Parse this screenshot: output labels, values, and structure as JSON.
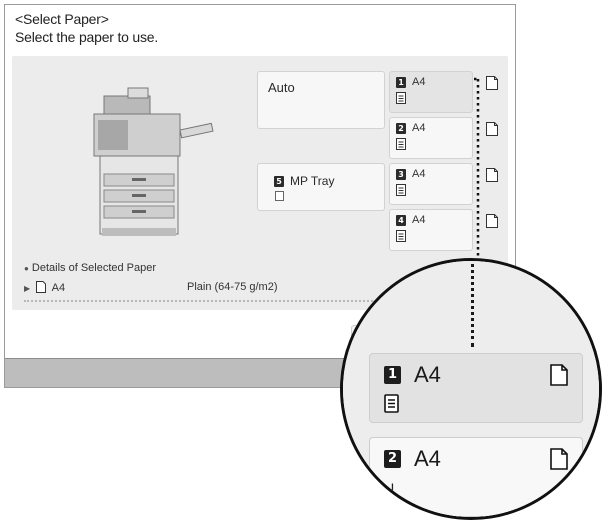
{
  "header": {
    "title": "<Select Paper>",
    "instruction": "Select the paper to use."
  },
  "sources": {
    "auto": {
      "label": "Auto"
    },
    "mp_tray": {
      "badge": "5",
      "label": "MP Tray"
    }
  },
  "drawers": [
    {
      "badge": "1",
      "size": "A4",
      "selected": true
    },
    {
      "badge": "2",
      "size": "A4",
      "selected": false
    },
    {
      "badge": "3",
      "size": "A4",
      "selected": false
    },
    {
      "badge": "4",
      "size": "A4",
      "selected": false
    }
  ],
  "details": {
    "title": "Details of Selected Paper",
    "size": "A4",
    "type": "Plain (64-75 g/m2)"
  },
  "magnifier": {
    "drawer1": {
      "badge": "1",
      "size": "A4"
    },
    "drawer2": {
      "badge": "2",
      "size": "A4"
    }
  },
  "icons": [
    "printer-illustration",
    "paper-stack-icon",
    "paper-orientation-icon",
    "paper-sheet-icon",
    "bullet-arrow-icon"
  ]
}
